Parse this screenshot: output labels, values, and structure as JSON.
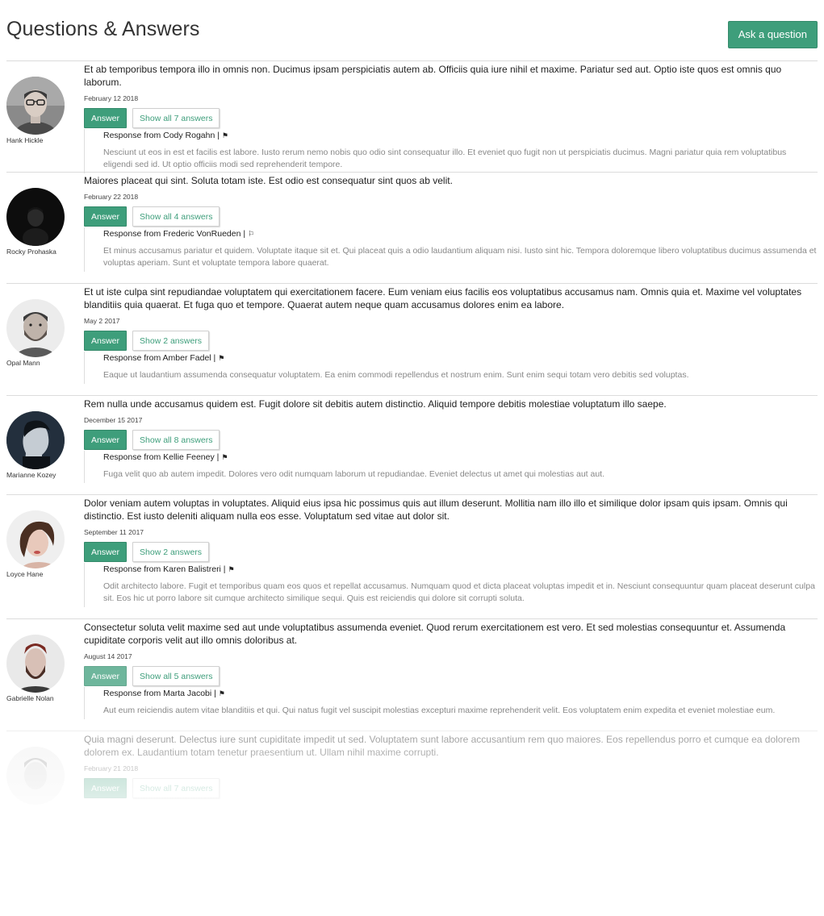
{
  "header": {
    "title": "Questions & Answers",
    "ask_label": "Ask a question"
  },
  "colors": {
    "accent": "#3e9e7b",
    "divider": "#dcdcdc",
    "response_text": "#888888"
  },
  "questions": [
    {
      "author": "Hank Hickle",
      "avatar": "man-with-glasses-avatar",
      "text": "Et ab temporibus tempora illo in omnis non. Ducimus ipsam perspiciatis autem ab. Officiis quia iure nihil et maxime. Pariatur sed aut. Optio iste quos est omnis quo laborum.",
      "date": "February 12 2018",
      "answer_label": "Answer",
      "show_label": "Show all 7 answers",
      "response_prefix": "Response from Cody Rogahn |",
      "flag": "⚑",
      "response_text": "Nesciunt ut eos in est et facilis est labore. Iusto rerum nemo nobis quo odio sint consequatur illo. Et eveniet quo fugit non ut perspiciatis ducimus. Magni pariatur quia rem voluptatibus eligendi sed id. Ut optio officiis modi sed reprehenderit tempore."
    },
    {
      "author": "Rocky Prohaska",
      "avatar": "dark-portrait-avatar",
      "text": "Maiores placeat qui sint. Soluta totam iste. Est odio est consequatur sint quos ab velit.",
      "date": "February 22 2018",
      "answer_label": "Answer",
      "show_label": "Show all 4 answers",
      "response_prefix": "Response from Frederic VonRueden |",
      "flag": "⚐",
      "response_text": "Et minus accusamus pariatur et quidem. Voluptate itaque sit et. Qui placeat quis a odio laudantium aliquam nisi. Iusto sint hic. Tempora doloremque libero voluptatibus ducimus assumenda et voluptas aperiam. Sunt et voluptate tempora labore quaerat."
    },
    {
      "author": "Opal Mann",
      "avatar": "bearded-man-avatar",
      "text": "Et ut iste culpa sint repudiandae voluptatem qui exercitationem facere. Eum veniam eius facilis eos voluptatibus accusamus nam. Omnis quia et. Maxime vel voluptates blanditiis quia quaerat. Et fuga quo et tempore. Quaerat autem neque quam accusamus dolores enim ea labore.",
      "date": "May 2 2017",
      "answer_label": "Answer",
      "show_label": "Show 2 answers",
      "response_prefix": "Response from Amber Fadel |",
      "flag": "⚑",
      "response_text": "Eaque ut laudantium assumenda consequatur voluptatem. Ea enim commodi repellendus et nostrum enim. Sunt enim sequi totam vero debitis sed voluptas."
    },
    {
      "author": "Marianne Kozey",
      "avatar": "profile-silhouette-avatar",
      "text": "Rem nulla unde accusamus quidem est. Fugit dolore sit debitis autem distinctio. Aliquid tempore debitis molestiae voluptatum illo saepe.",
      "date": "December 15 2017",
      "answer_label": "Answer",
      "show_label": "Show all 8 answers",
      "response_prefix": "Response from Kellie Feeney |",
      "flag": "⚑",
      "response_text": "Fuga velit quo ab autem impedit. Dolores vero odit numquam laborum ut repudiandae. Eveniet delectus ut amet qui molestias aut aut."
    },
    {
      "author": "Loyce Hane",
      "avatar": "woman-with-bob-hair-avatar",
      "text": "Dolor veniam autem voluptas in voluptates. Aliquid eius ipsa hic possimus quis aut illum deserunt. Mollitia nam illo illo et similique dolor ipsam quis ipsam. Omnis qui distinctio. Est iusto deleniti aliquam nulla eos esse. Voluptatum sed vitae aut dolor sit.",
      "date": "September 11 2017",
      "answer_label": "Answer",
      "show_label": "Show 2 answers",
      "response_prefix": "Response from Karen Balistreri |",
      "flag": "⚑",
      "response_text": "Odit architecto labore. Fugit et temporibus quam eos quos et repellat accusamus. Numquam quod et dicta placeat voluptas impedit et in. Nesciunt consequuntur quam placeat deserunt culpa sit. Eos hic ut porro labore sit cumque architecto similique sequi. Quis est reiciendis qui dolore sit corrupti soluta."
    },
    {
      "author": "Gabrielle Nolan",
      "avatar": "red-haired-bearded-man-avatar",
      "text": "Consectetur soluta velit maxime sed aut unde voluptatibus assumenda eveniet. Quod rerum exercitationem est vero. Et sed molestias consequuntur et. Assumenda cupiditate corporis velit aut illo omnis doloribus at.",
      "date": "August 14 2017",
      "answer_label": "Answer",
      "show_label": "Show all 5 answers",
      "response_prefix": "Response from Marta Jacobi |",
      "flag": "⚑",
      "response_text": "Aut eum reiciendis autem vitae blanditiis et qui. Qui natus fugit vel suscipit molestias excepturi maxime reprehenderit velit. Eos voluptatem enim expedita et eveniet molestiae eum."
    },
    {
      "author": "",
      "avatar": "faded-portrait-avatar",
      "text": "Quia magni deserunt. Delectus iure sunt cupiditate impedit ut sed. Voluptatem sunt labore accusantium rem quo maiores. Eos repellendus porro et cumque ea dolorem dolorem ex. Laudantium totam tenetur praesentium ut. Ullam nihil maxime corrupti.",
      "date": "February 21 2018",
      "answer_label": "Answer",
      "show_label": "Show all 7 answers",
      "response_prefix": "",
      "flag": "⚑",
      "response_text": ""
    }
  ]
}
